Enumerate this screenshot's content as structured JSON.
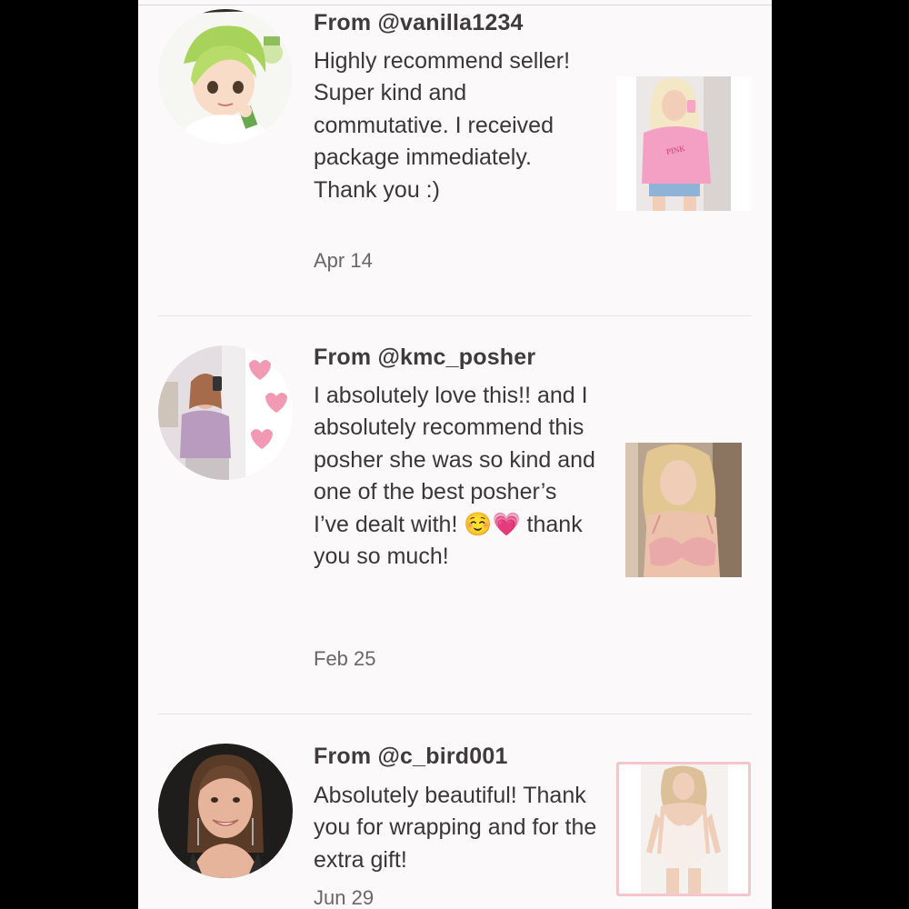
{
  "reviews": [
    {
      "from": "From @vanilla1234",
      "text": "Highly recommend seller! Super kind and commutative. I received package immediately. Thank you :)",
      "date": "Apr 14",
      "avatar_icon": "anime-girl-avatar",
      "thumb_icon": "pink-sweatshirt-photo"
    },
    {
      "from": "From @kmc_posher",
      "text": "I absolutely love this!! and I absolutely recommend this posher she was so kind and one of the best posher’s I’ve dealt with! ☺️💗 thank you so much!",
      "date": "Feb 25",
      "avatar_icon": "selfie-avatar",
      "thumb_icon": "pink-bra-photo"
    },
    {
      "from": "From @c_bird001",
      "text": "Absolutely beautiful! Thank you for wrapping and for the extra gift!",
      "date": "Jun 29",
      "avatar_icon": "smiling-woman-avatar",
      "thumb_icon": "white-bodysuit-photo"
    }
  ],
  "colors": {
    "background": "#fcf9fa",
    "text": "#3b3638",
    "date": "#6b6567",
    "thumb_border": "#f4c6cd"
  }
}
